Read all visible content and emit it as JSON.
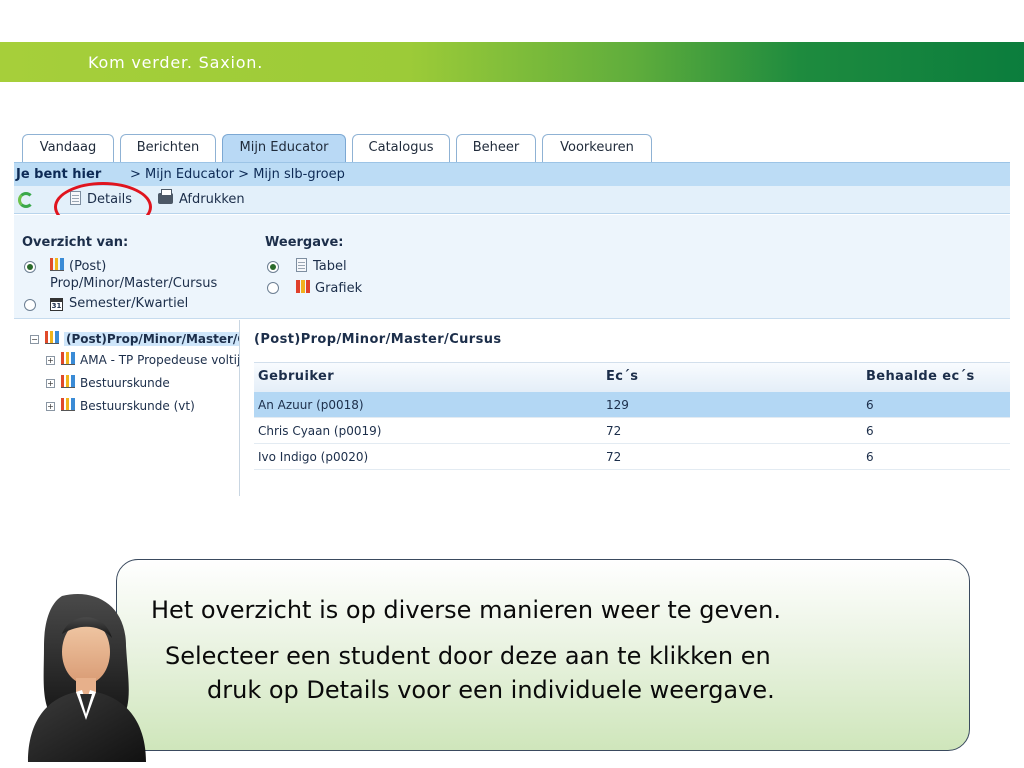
{
  "banner": {
    "tagline": "Kom verder. Saxion."
  },
  "tabs": [
    {
      "label": "Vandaag",
      "active": false
    },
    {
      "label": "Berichten",
      "active": false
    },
    {
      "label": "Mijn Educator",
      "active": true
    },
    {
      "label": "Catalogus",
      "active": false
    },
    {
      "label": "Beheer",
      "active": false
    },
    {
      "label": "Voorkeuren",
      "active": false
    }
  ],
  "breadcrumb": {
    "lead": "Je bent hier",
    "rest": ">  Mijn Educator > Mijn slb-groep"
  },
  "toolbar": {
    "details_label": "Details",
    "print_label": "Afdrukken"
  },
  "options": {
    "overview_title": "Overzicht van:",
    "overview_choices": [
      {
        "label_line1": "(Post)",
        "label_line2": "Prop/Minor/Master/Cursus",
        "selected": true
      },
      {
        "label_line1": "Semester/Kwartiel",
        "selected": false
      }
    ],
    "calendar_day": "31",
    "view_title": "Weergave:",
    "view_choices": [
      {
        "label": "Tabel",
        "selected": true
      },
      {
        "label": "Grafiek",
        "selected": false
      }
    ]
  },
  "tree": {
    "root": "(Post)Prop/Minor/Master/Cursus",
    "children": [
      "AMA - TP Propedeuse voltijd",
      "Bestuurskunde",
      "Bestuurskunde (vt)"
    ],
    "expand_symbol": "+",
    "collapse_symbol": "−"
  },
  "content": {
    "title": "(Post)Prop/Minor/Master/Cursus",
    "columns": [
      "Gebruiker",
      "Ec´s",
      "Behaalde ec´s"
    ],
    "rows": [
      {
        "user": "An Azuur (p0018)",
        "ecs": "129",
        "earned": "6",
        "selected": true
      },
      {
        "user": "Chris Cyaan (p0019)",
        "ecs": "72",
        "earned": "6",
        "selected": false
      },
      {
        "user": "Ivo Indigo (p0020)",
        "ecs": "72",
        "earned": "6",
        "selected": false
      }
    ]
  },
  "bubble": {
    "line1": "Het overzicht is op diverse manieren weer te geven.",
    "line2": "Selecteer een student door deze aan te klikken en",
    "line3": "druk op Details voor een individuele weergave."
  },
  "colors": {
    "highlight_circle": "#e0141e",
    "banner_dark": "#0b7d3d",
    "banner_light": "#a6cf3a",
    "selected_row": "#b3d7f4"
  }
}
